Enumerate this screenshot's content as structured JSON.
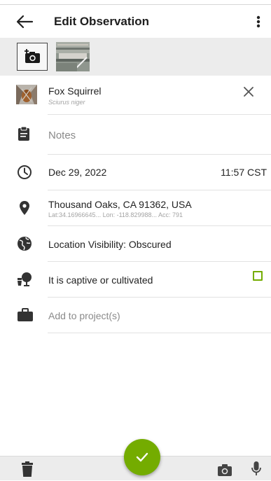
{
  "header": {
    "title": "Edit Observation",
    "back_icon": "arrow-left-icon",
    "menu_icon": "more-vertical-icon"
  },
  "photos": {
    "add_icon": "add-photo-icon",
    "count": 1
  },
  "taxon": {
    "common_name": "Fox Squirrel",
    "scientific_name": "Sciurus niger",
    "clear_icon": "close-icon"
  },
  "notes": {
    "placeholder": "Notes",
    "icon": "clipboard-icon"
  },
  "datetime": {
    "date": "Dec 29, 2022",
    "time": "11:57 CST",
    "icon": "clock-icon"
  },
  "location": {
    "place": "Thousand Oaks, CA 91362, USA",
    "details": "Lat:34.16966645...  Lon: -118.829988...  Acc: 791",
    "icon": "map-pin-icon"
  },
  "visibility": {
    "label": "Location Visibility: Obscured",
    "icon": "globe-icon"
  },
  "captive": {
    "label": "It is captive or cultivated",
    "checked": false,
    "icon": "potted-plant-icon"
  },
  "projects": {
    "label": "Add to project(s)",
    "icon": "briefcase-icon"
  },
  "bottom": {
    "delete_icon": "trash-icon",
    "camera_icon": "camera-icon",
    "mic_icon": "microphone-icon",
    "save_icon": "check-icon"
  },
  "colors": {
    "accent": "#74ac00",
    "icon": "#333333",
    "muted_text": "#8a8a8a",
    "strip_bg": "#ececec"
  }
}
